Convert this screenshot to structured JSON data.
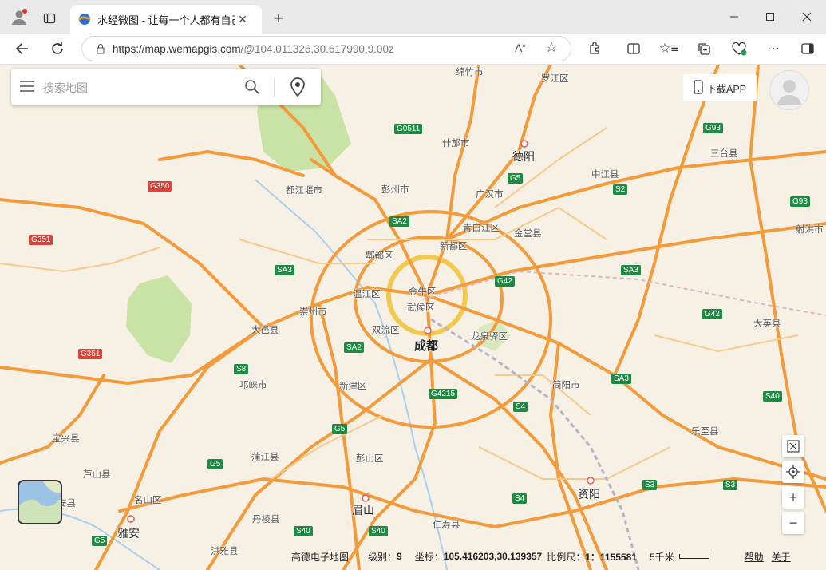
{
  "browser": {
    "tab_title": "水经微图 - 让每一个人都有自己的",
    "url_host": "https://map.wemapgis.com",
    "url_path": "/@104.011326,30.617990,9.00z"
  },
  "search": {
    "placeholder": "搜索地图"
  },
  "download_label": "下载APP",
  "status": {
    "provider": "高德电子地图",
    "level_label": "级别：",
    "level_value": "9",
    "coord_label": "坐标：",
    "coord_value": "105.416203,30.139357",
    "scale_label": "比例尺：",
    "scale_value": "1：1155581",
    "scale_bar": "5千米",
    "help": "帮助",
    "about": "关于"
  },
  "map_labels": [
    {
      "text": "绵竹市",
      "cls": ""
    },
    {
      "text": "罗江区",
      "cls": ""
    },
    {
      "text": "德阳",
      "cls": "mid"
    },
    {
      "text": "什邡市",
      "cls": ""
    },
    {
      "text": "中江县",
      "cls": ""
    },
    {
      "text": "三台县",
      "cls": ""
    },
    {
      "text": "都江堰市",
      "cls": ""
    },
    {
      "text": "彭州市",
      "cls": ""
    },
    {
      "text": "广汉市",
      "cls": ""
    },
    {
      "text": "青白江区",
      "cls": ""
    },
    {
      "text": "金堂县",
      "cls": ""
    },
    {
      "text": "新都区",
      "cls": ""
    },
    {
      "text": "郫都区",
      "cls": ""
    },
    {
      "text": "金牛区",
      "cls": ""
    },
    {
      "text": "温江区",
      "cls": ""
    },
    {
      "text": "武侯区",
      "cls": ""
    },
    {
      "text": "崇州市",
      "cls": ""
    },
    {
      "text": "双流区",
      "cls": ""
    },
    {
      "text": "龙泉驿区",
      "cls": ""
    },
    {
      "text": "成都",
      "cls": "big"
    },
    {
      "text": "大邑县",
      "cls": ""
    },
    {
      "text": "大英县",
      "cls": ""
    },
    {
      "text": "射洪市",
      "cls": ""
    },
    {
      "text": "邛崃市",
      "cls": ""
    },
    {
      "text": "新津区",
      "cls": ""
    },
    {
      "text": "简阳市",
      "cls": ""
    },
    {
      "text": "乐至县",
      "cls": ""
    },
    {
      "text": "宝兴县",
      "cls": ""
    },
    {
      "text": "蒲江县",
      "cls": ""
    },
    {
      "text": "彭山区",
      "cls": ""
    },
    {
      "text": "芦山县",
      "cls": ""
    },
    {
      "text": "名山区",
      "cls": ""
    },
    {
      "text": "资阳",
      "cls": "mid"
    },
    {
      "text": "眉山",
      "cls": "mid"
    },
    {
      "text": "雅安",
      "cls": "mid"
    },
    {
      "text": "丹棱县",
      "cls": ""
    },
    {
      "text": "仁寿县",
      "cls": ""
    },
    {
      "text": "洪雅县",
      "cls": ""
    },
    {
      "text": "安县",
      "cls": ""
    }
  ],
  "road_shields": [
    {
      "text": "G0511",
      "color": "g"
    },
    {
      "text": "G93",
      "color": "g"
    },
    {
      "text": "G5",
      "color": "g"
    },
    {
      "text": "S2",
      "color": "g"
    },
    {
      "text": "G93",
      "color": "g"
    },
    {
      "text": "G350",
      "color": "r"
    },
    {
      "text": "SA2",
      "color": "g"
    },
    {
      "text": "G351",
      "color": "r"
    },
    {
      "text": "SA3",
      "color": "g"
    },
    {
      "text": "G42",
      "color": "g"
    },
    {
      "text": "SA3",
      "color": "g"
    },
    {
      "text": "G42",
      "color": "g"
    },
    {
      "text": "SA2",
      "color": "g"
    },
    {
      "text": "G351",
      "color": "r"
    },
    {
      "text": "S8",
      "color": "g"
    },
    {
      "text": "SA3",
      "color": "g"
    },
    {
      "text": "G4215",
      "color": "g"
    },
    {
      "text": "S4",
      "color": "g"
    },
    {
      "text": "S40",
      "color": "g"
    },
    {
      "text": "G5",
      "color": "g"
    },
    {
      "text": "G5",
      "color": "g"
    },
    {
      "text": "S3",
      "color": "g"
    },
    {
      "text": "S3",
      "color": "g"
    },
    {
      "text": "S4",
      "color": "g"
    },
    {
      "text": "S40",
      "color": "g"
    },
    {
      "text": "S40",
      "color": "g"
    },
    {
      "text": "G5",
      "color": "g"
    }
  ]
}
